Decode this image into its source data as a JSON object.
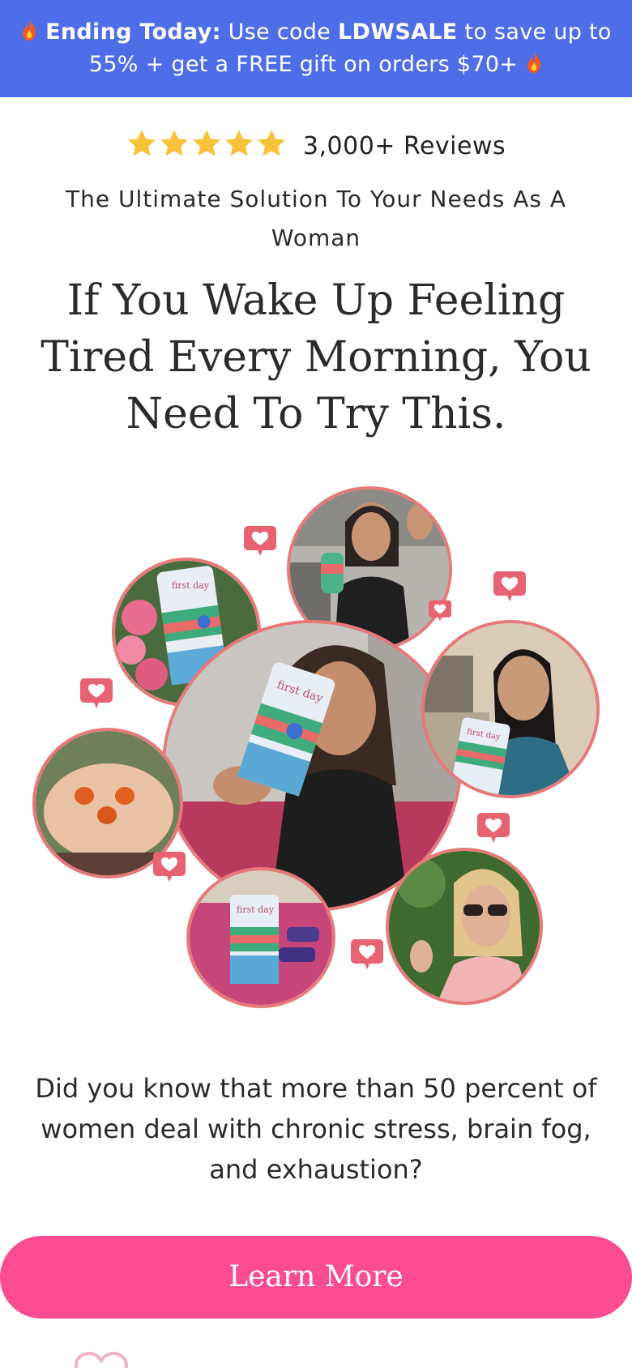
{
  "promo": {
    "lead": "Ending Today:",
    "text_before_code": " Use code ",
    "code": "LDWSALE",
    "text_after_code": " to save up to 55% + get a FREE gift on orders $70+"
  },
  "reviews": {
    "rating_stars": 5,
    "label": "3,000+ Reviews"
  },
  "tagline": "The Ultimate Solution To Your Needs As A Woman",
  "headline": "If You Wake Up Feeling Tired Every Morning, You Need To Try This.",
  "collage": {
    "bubbles": [
      {
        "name": "photo-woman-waving",
        "caption": ""
      },
      {
        "name": "photo-product-flowers",
        "caption": "first day"
      },
      {
        "name": "photo-woman-holding-product",
        "caption": "first day"
      },
      {
        "name": "photo-woman-kitchen",
        "caption": "first day"
      },
      {
        "name": "photo-gummies-hand",
        "caption": ""
      },
      {
        "name": "photo-product-dumbbells",
        "caption": "first day"
      },
      {
        "name": "photo-woman-sunglasses",
        "caption": ""
      }
    ],
    "product_label": "first day"
  },
  "question": "Did you know that more than 50 percent of women deal with chronic stress, brain fog, and exhaustion?",
  "cta": {
    "label": "Learn More"
  },
  "colors": {
    "promo_bg": "#4d6ee8",
    "cta_bg": "#fb4b91",
    "bubble_border": "#e77979",
    "star": "#f8c13a"
  }
}
